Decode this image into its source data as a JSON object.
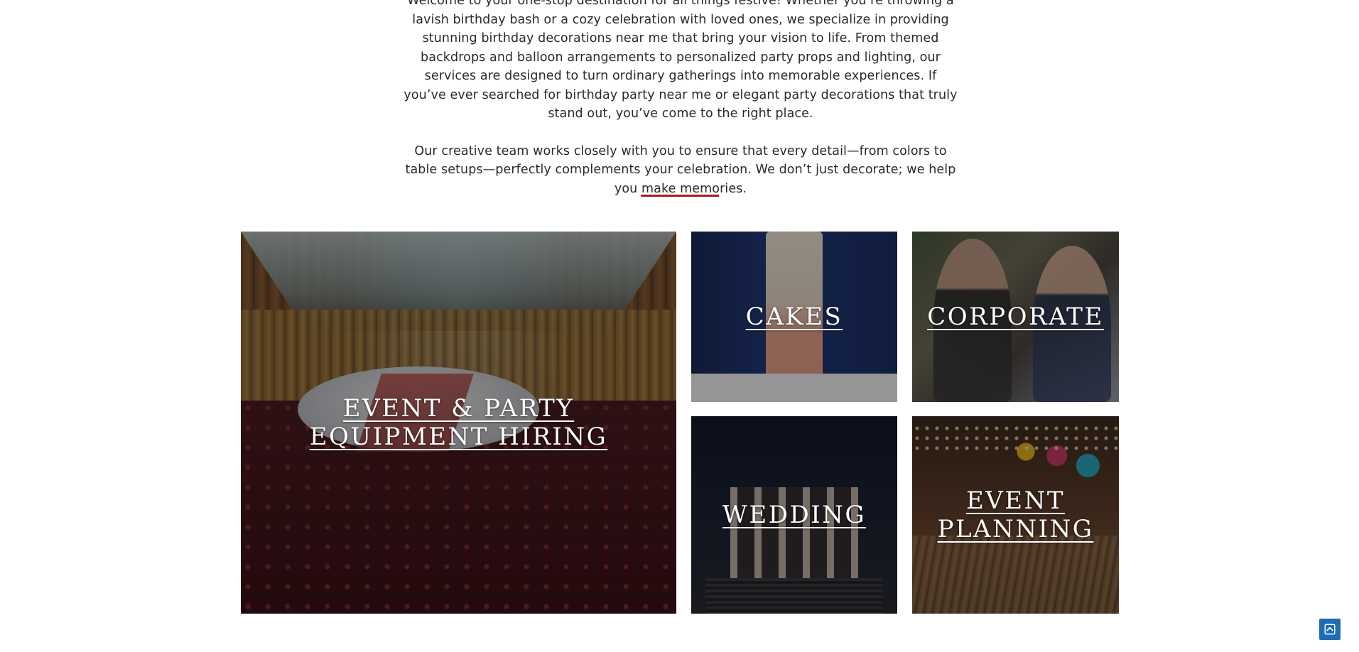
{
  "intro": {
    "paragraph1": "Welcome to your one-stop destination for all things festive! Whether you’re throwing a lavish birthday bash or a cozy celebration with loved ones, we specialize in providing stunning birthday decorations near me that bring your vision to life. From themed backdrops and balloon arrangements to personalized party props and lighting, our services are designed to turn ordinary gatherings into memorable experiences. If you’ve ever searched for birthday party near me or elegant party decorations that truly stand out, you’ve come to the right place.",
    "paragraph2": "Our creative team works closely with you to ensure that every detail—from colors to table setups—perfectly complements your celebration. We don’t just decorate; we help you make memories."
  },
  "colors": {
    "divider": "#a81d1d",
    "scroll_top": "#1f6db5"
  },
  "tiles": {
    "hall": {
      "label": "EVENT & PARTY EQUIPMENT HIRING"
    },
    "cakes": {
      "label": "CAKES"
    },
    "corporate": {
      "label": "CORPORATE"
    },
    "wedding": {
      "label": "WEDDING"
    },
    "planning": {
      "label": "EVENT PLANNING"
    }
  },
  "scroll_top": {
    "icon": "arrow-up-icon"
  }
}
